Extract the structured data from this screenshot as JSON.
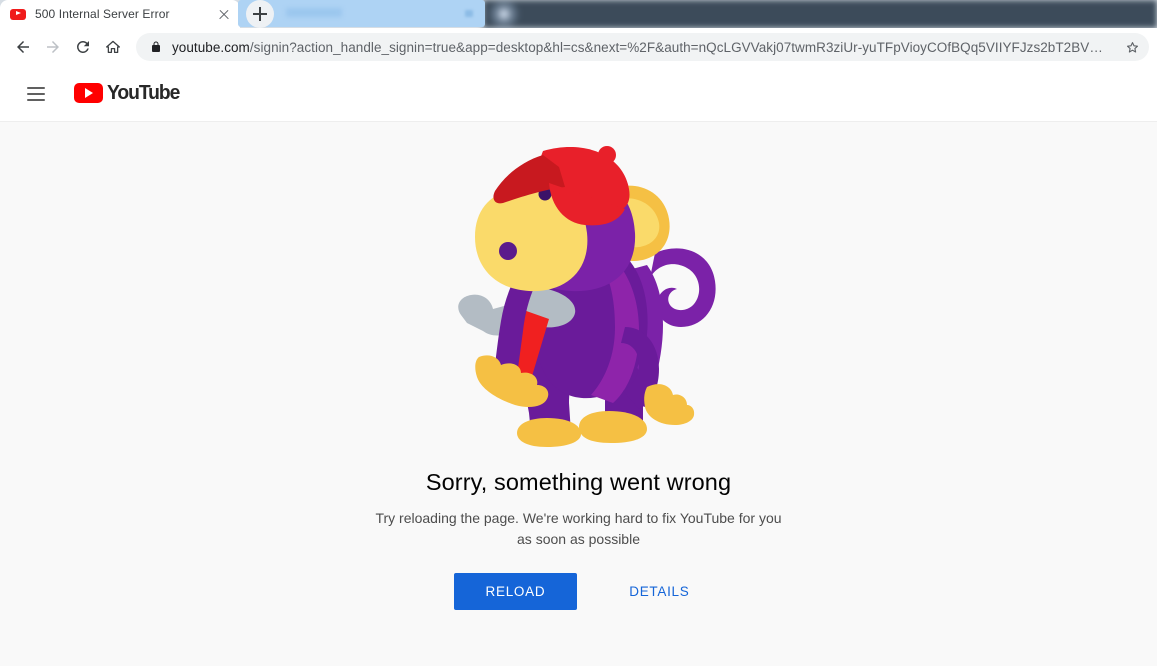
{
  "browser": {
    "tabs": [
      {
        "title": "500 Internal Server Error",
        "favicon": "youtube-favicon",
        "active": true
      },
      {
        "title": "",
        "favicon": "",
        "active": false
      }
    ],
    "new_tab_label": "+",
    "nav": {
      "back_label": "Back",
      "forward_label": "Forward",
      "reload_label": "Reload",
      "home_label": "Home"
    },
    "omnibox": {
      "lock_icon": "lock-icon",
      "url_host": "youtube.com",
      "url_path": "/signin?action_handle_signin=true&app=desktop&hl=cs&next=%2F&auth=nQcLGVVakj07twmR3ziUr-yuTFpVioyCOfBQq5VIIYFJzs2bT2BV…",
      "star_icon": "star-icon"
    }
  },
  "youtube": {
    "header": {
      "menu_icon": "hamburger-menu-icon",
      "logo_text": "YouTube"
    },
    "error": {
      "illustration": "monkey-with-hammer-illustration",
      "title": "Sorry, something went wrong",
      "subtitle": "Try reloading the page. We're working hard to fix YouTube for you as soon as possible",
      "reload_label": "RELOAD",
      "details_label": "DETAILS"
    }
  },
  "colors": {
    "youtube_red": "#ff0000",
    "action_blue": "#1565d8",
    "page_background": "#f9f9f9",
    "header_background": "#ffffff",
    "monkey_purple_dark": "#6a1b9a",
    "monkey_purple_light": "#8e24aa",
    "monkey_yellow": "#f9c846",
    "monkey_yellow_light": "#fada6a",
    "cap_red": "#e8202a",
    "cap_red_dark": "#c8191f",
    "hammer_gray": "#b3bcc4",
    "hammer_handle_red": "#f02020"
  }
}
